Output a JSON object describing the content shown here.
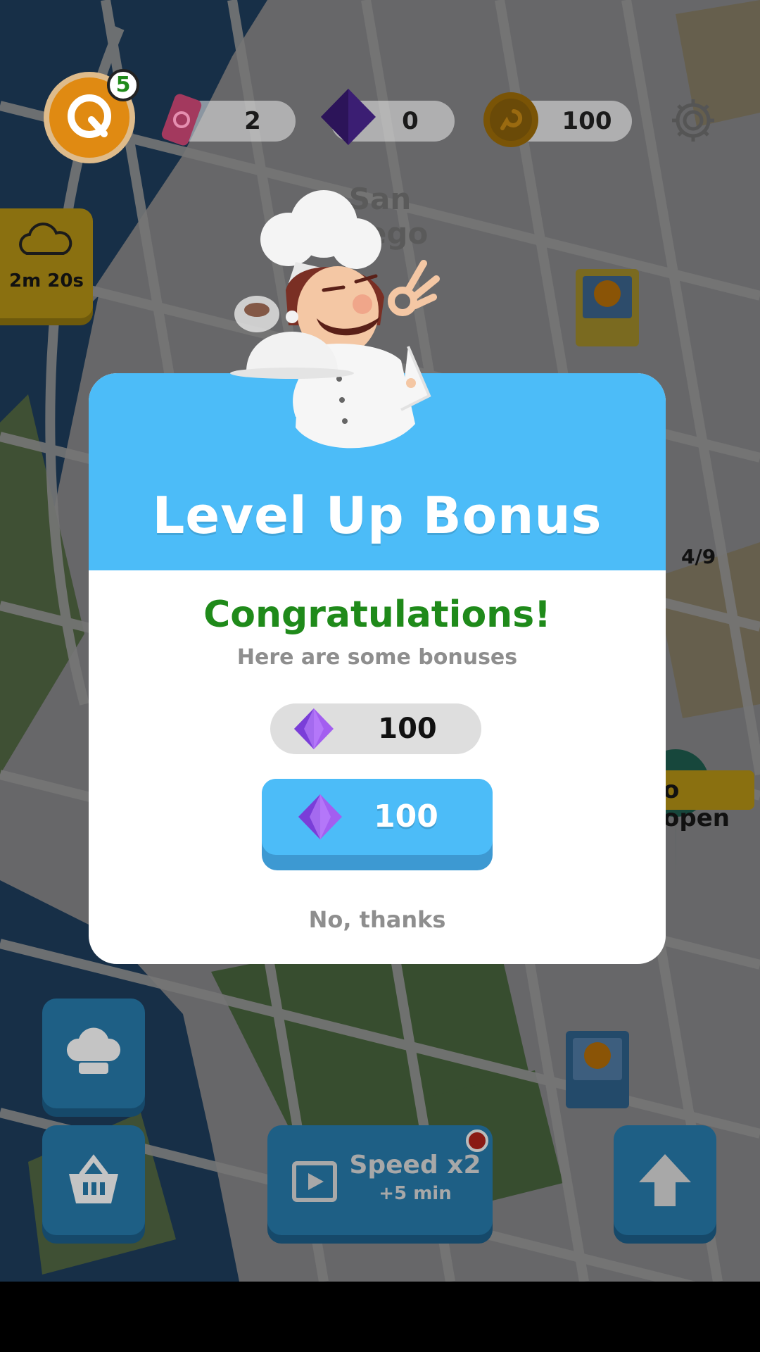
{
  "hud": {
    "level_badge": "5",
    "tickets_count": "2",
    "gems_count": "0",
    "coins_count": "100",
    "settings_icon": "gear-icon"
  },
  "map": {
    "city_label": "San Diego",
    "timer_label": "2m 20s",
    "progress_label": "4/9",
    "open_label": "o open"
  },
  "modal": {
    "title": "Level  Up Bonus",
    "congrats": "Congratulations!",
    "subtitle": "Here are some bonuses",
    "reward_value": "100",
    "claim_value": "100",
    "dismiss_label": "No, thanks"
  },
  "bottom": {
    "speed_title": "Speed x2",
    "speed_sub": "+5 min"
  },
  "colors": {
    "modal_header": "#4cbcf8",
    "congrats_green": "#1f8a1a",
    "button_blue": "#2b8fc7",
    "gem_purple": "#7a3ed8",
    "coin_orange": "#e08a12"
  }
}
